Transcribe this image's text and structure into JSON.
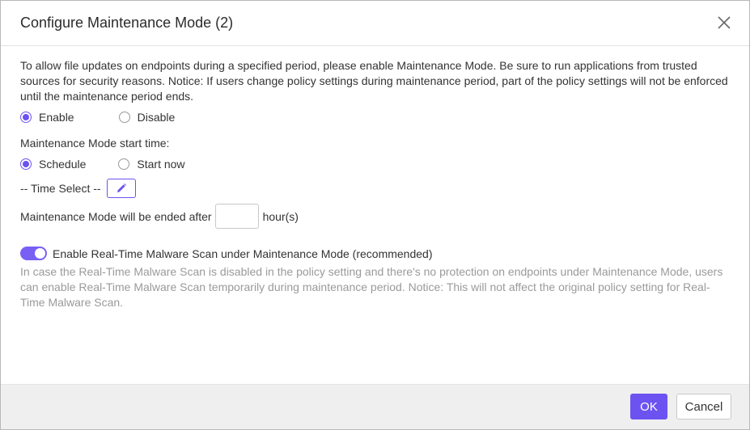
{
  "dialog": {
    "title": "Configure Maintenance Mode (2)",
    "close_icon": "close-icon"
  },
  "intro_text": "To allow file updates on endpoints during a specified period, please enable Maintenance Mode. Be sure to run applications from trusted sources for security reasons. Notice: If users change policy settings during maintenance period, part of the policy settings will not be enforced until the maintenance period ends.",
  "mode": {
    "options": [
      {
        "label": "Enable",
        "checked": true
      },
      {
        "label": "Disable",
        "checked": false
      }
    ]
  },
  "start_time": {
    "label": "Maintenance Mode start time:",
    "options": [
      {
        "label": "Schedule",
        "checked": true
      },
      {
        "label": "Start now",
        "checked": false
      }
    ],
    "time_select_label": "-- Time Select --",
    "edit_icon": "pencil-icon"
  },
  "end": {
    "label": "Maintenance Mode will be ended after",
    "hours_value": "",
    "unit": "hour(s)"
  },
  "malware_scan": {
    "toggle_on": true,
    "label": "Enable Real-Time Malware Scan under Maintenance Mode (recommended)",
    "note": "In case the Real-Time Malware Scan is disabled in the policy setting and there's no protection on endpoints under Maintenance Mode, users can enable Real-Time Malware Scan temporarily during maintenance period. Notice: This will not affect the original policy setting for Real-Time Malware Scan."
  },
  "footer": {
    "ok_label": "OK",
    "cancel_label": "Cancel"
  },
  "colors": {
    "accent": "#6d52f2",
    "toggle": "#7a5ff5",
    "footer_bg": "#efefef"
  }
}
